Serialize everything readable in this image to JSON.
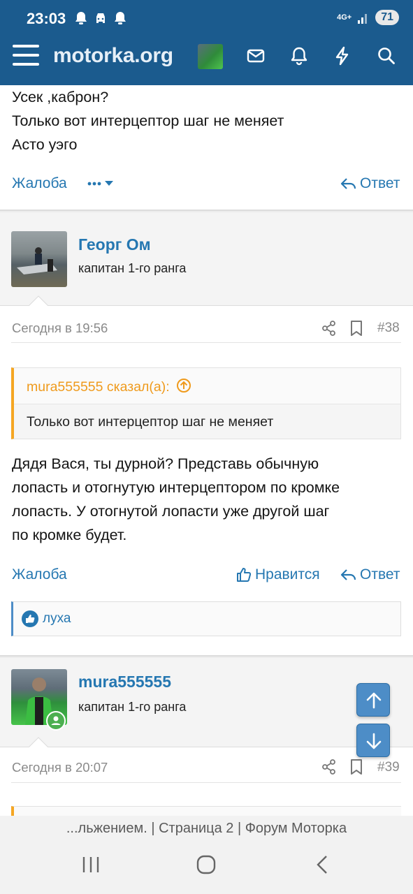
{
  "statusbar": {
    "time": "23:03",
    "network": "4G+",
    "battery": "71"
  },
  "nav": {
    "logo": "motorka.org"
  },
  "post_prev": {
    "lines": [
      "Усек ,каброн?",
      "Только вот интерцептор шаг не меняет",
      "Асто уэго"
    ],
    "report": "Жалоба",
    "reply": "Ответ"
  },
  "post38": {
    "author": "Георг Ом",
    "author_title": "капитан 1-го ранга",
    "date": "Сегодня в 19:56",
    "number": "#38",
    "quote_author": "mura555555 сказал(а):",
    "quote_text": "Только вот интерцептор шаг не меняет",
    "lines": [
      "Дядя Вася, ты дурной? Представь обычную",
      "лопасть и отогнутую интерцептором по кромке",
      "лопасть. У отогнутой лопасти уже другой шаг",
      "по кромке будет."
    ],
    "report": "Жалоба",
    "like": "Нравится",
    "reply": "Ответ",
    "reactions": "луха"
  },
  "post39": {
    "author": "mura555555",
    "author_title": "капитан 1-го ранга",
    "date": "Сегодня в 20:07",
    "number": "#39"
  },
  "browser": {
    "page_title": "...льжением. | Страница 2 | Форум Моторка"
  },
  "colors": {
    "header": "#1b5b8e",
    "link": "#2577b1",
    "quote_accent": "#f5a623",
    "online": "#4caf50"
  }
}
